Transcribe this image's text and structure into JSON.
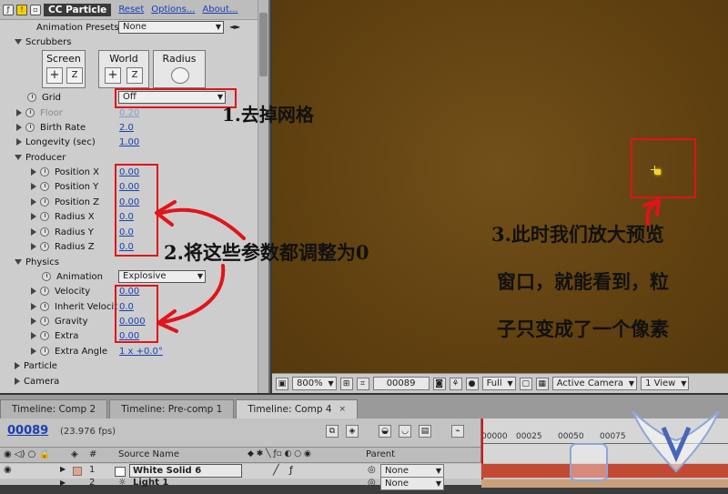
{
  "effect_controls": {
    "effect_name": "CC Particle",
    "reset": "Reset",
    "options": "Options...",
    "about": "About...",
    "animation_presets_label": "Animation Presets:",
    "animation_presets_value": "None",
    "scrubbers_label": "Scrubbers",
    "scrubbers": {
      "screen": "Screen",
      "world": "World",
      "radius": "Radius",
      "plus": "+",
      "z": "Z"
    },
    "grid_label": "Grid",
    "grid_value": "Off",
    "floor_label": "Floor",
    "floor_value": "0.20",
    "birth_rate_label": "Birth Rate",
    "birth_rate_value": "2.0",
    "longevity_label": "Longevity (sec)",
    "longevity_value": "1.00",
    "producer_label": "Producer",
    "producer": [
      {
        "label": "Position X",
        "value": "0.00"
      },
      {
        "label": "Position Y",
        "value": "0.00"
      },
      {
        "label": "Position Z",
        "value": "0.00"
      },
      {
        "label": "Radius X",
        "value": "0.0"
      },
      {
        "label": "Radius Y",
        "value": "0.0"
      },
      {
        "label": "Radius Z",
        "value": "0.0"
      }
    ],
    "physics_label": "Physics",
    "animation_label": "Animation",
    "animation_value": "Explosive",
    "physics": [
      {
        "label": "Velocity",
        "value": "0.00"
      },
      {
        "label": "Inherit Velocit",
        "value": "0.0"
      },
      {
        "label": "Gravity",
        "value": "0.000"
      },
      {
        "label": "Extra",
        "value": "0.00"
      },
      {
        "label": "Extra Angle",
        "value": "1 x +0.0°"
      }
    ],
    "particle_label": "Particle",
    "camera_label": "Camera"
  },
  "annotations": {
    "note1": "1.去掉网格",
    "note2": "2.将这些参数都调整为0",
    "note3_line1": "3.此时我们放大预览",
    "note3_line2": "窗口，就能看到，粒",
    "note3_line3": "子只变成了一个像素"
  },
  "viewer_toolbar": {
    "zoom": "800%",
    "timecode": "00089",
    "resolution": "Full",
    "camera": "Active Camera",
    "views": "1 View"
  },
  "timeline": {
    "tabs": [
      {
        "label": "Timeline: Comp 2"
      },
      {
        "label": "Timeline: Pre-comp 1"
      },
      {
        "label": "Timeline: Comp 4"
      }
    ],
    "timecode": "00089",
    "fps": "(23.976 fps)",
    "source_name_header": "Source Name",
    "parent_header": "Parent",
    "ruler_ticks": [
      "00000",
      "00025",
      "00050",
      "00075"
    ],
    "layers": [
      {
        "num": "1",
        "name": "White Solid 6",
        "parent": "None"
      },
      {
        "num": "2",
        "name": "Light 1",
        "parent": "None"
      }
    ]
  },
  "colors": {
    "annotation_red": "#e0141a",
    "link_blue": "#1a3fb0",
    "comp_bg": "#5e3f0f"
  }
}
